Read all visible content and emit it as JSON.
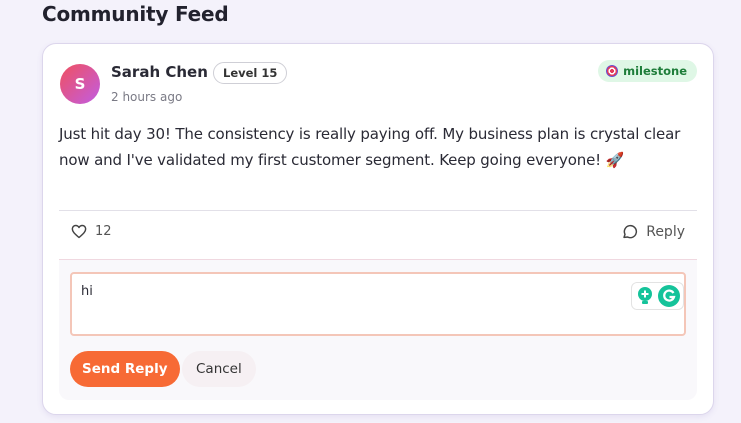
{
  "feed": {
    "title": "Community Feed"
  },
  "post": {
    "avatar_initial": "S",
    "author": "Sarah Chen",
    "level": "Level 15",
    "timestamp": "2 hours ago",
    "tag": "milestone",
    "body": "Just hit day 30! The consistency is really paying off. My business plan is crystal clear now and I've validated my first customer segment. Keep going everyone! 🚀",
    "likes": "12",
    "reply_label": "Reply"
  },
  "reply_form": {
    "value": "hi",
    "send_label": "Send Reply",
    "cancel_label": "Cancel"
  },
  "icons": {
    "like": "heart-icon",
    "reply": "comment-bubble-icon",
    "tag": "target-icon",
    "grammarly_suggest": "lightbulb-plus-icon",
    "grammarly_logo": "grammarly-g-icon"
  },
  "colors": {
    "accent": "#f76a35",
    "milestone_bg": "#dff7e6",
    "milestone_text": "#1e7d3a",
    "avatar_gradient_start": "#f0505f",
    "avatar_gradient_end": "#c15de3"
  }
}
